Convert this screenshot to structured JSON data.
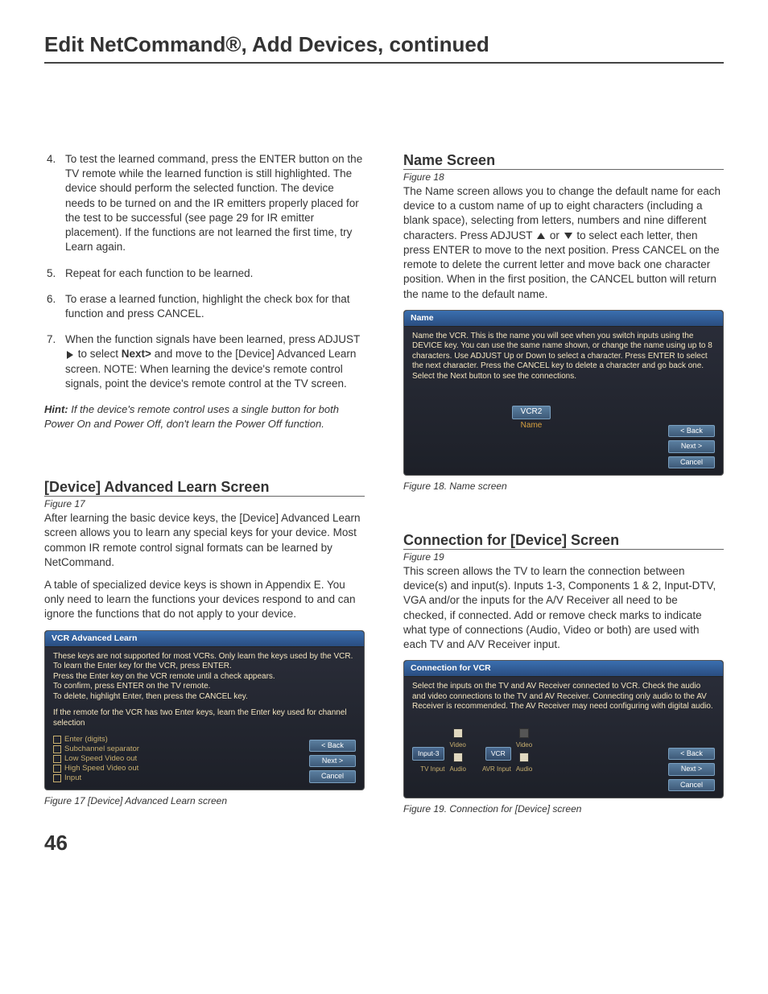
{
  "page": {
    "title": "Edit NetCommand®, Add Devices, continued",
    "number": "46"
  },
  "left": {
    "steps_start": 4,
    "step4": "To test the learned command, press the ENTER button on the TV remote while the learned function is still highlighted.  The device should perform the selected function.  The device needs to be turned on and the IR emitters properly placed for the test to be successful (see page 29 for IR emitter placement).  If the functions are not learned the first time, try Learn again.",
    "step5": "Repeat for each function to be learned.",
    "step6": "To erase a learned function, highlight the check box for that function and press CANCEL.",
    "step7_a": "When the function signals have been learned, press ADJUST ",
    "step7_b": "  to select ",
    "step7_next": "Next>",
    "step7_c": " and move to the [Device] Advanced Learn screen. NOTE: When learning the device's remote control signals, point the device's remote control at the TV screen.",
    "hint_label": "Hint:",
    "hint_text": "  If the device's remote control uses a single button for both Power On and Power Off, don't learn the Power Off function.",
    "adv_title": "[Device] Advanced Learn Screen",
    "adv_figref": "Figure 17",
    "adv_p1": "After learning the basic device keys, the [Device] Advanced Learn screen allows you to learn any special keys for your device.  Most common IR remote control signal formats can be learned by NetCommand.",
    "adv_p2": "A table of specialized device keys is shown in Appendix E. You only need to learn the functions your devices respond to and can ignore the functions that do not apply to your device.",
    "panel17": {
      "title": "VCR Advanced Learn",
      "t1": "These keys are not supported for most VCRs. Only learn the keys used by the VCR.",
      "t2": "To learn the Enter key for the VCR, press ENTER.",
      "t3": "Press the Enter key on the VCR remote until a check appears.",
      "t4": "To confirm, press ENTER on the TV remote.",
      "t5": "To delete, highlight Enter, then press the CANCEL key.",
      "t6": "If the remote for the VCR has two Enter keys, learn the Enter key used for channel selection",
      "item1": "Enter (digits)",
      "item2": "Subchannel separator",
      "item3": "Low Speed Video out",
      "item4": "High Speed Video out",
      "item5": "Input",
      "btn_back": "< Back",
      "btn_next": "Next >",
      "btn_cancel": "Cancel"
    },
    "caption17": "Figure 17  [Device] Advanced Learn screen"
  },
  "right": {
    "name_title": "Name Screen",
    "name_figref": "Figure 18",
    "name_p_a": "The Name screen allows you to change the default name for each device to a custom name of up to eight characters (including a blank space), selecting from letters, numbers and nine different characters.  Press ADJUST ",
    "name_p_b": " or ",
    "name_p_c": " to select each letter, then press ENTER to move to the next position.  Press CANCEL on the remote to delete the current letter and move back one character position.  When in the first position, the CANCEL button will return the name to the default name.",
    "panel18": {
      "title": "Name",
      "instr": "Name the VCR.  This is the name you will see when you switch inputs using the DEVICE key.  You can use the same name shown, or change the name using up to 8 characters. Use ADJUST Up or Down to select a character.  Press ENTER to select the next character.  Press the CANCEL key to delete a character and go back one.  Select the Next button to see the connections.",
      "field_value": "VCR2",
      "field_label": "Name",
      "btn_back": "< Back",
      "btn_next": "Next >",
      "btn_cancel": "Cancel"
    },
    "caption18": "Figure 18.  Name screen",
    "conn_title": "Connection for [Device] Screen",
    "conn_figref": "Figure 19",
    "conn_p": "This screen allows the TV to learn the connection between device(s) and input(s).  Inputs 1-3, Components 1 & 2, Input-DTV, VGA and/or the inputs for the A/V Receiver all need to be checked, if connected.  Add or remove check marks to indicate what type of connections (Audio, Video or both) are used with each TV and A/V Receiver input.",
    "panel19": {
      "title": "Connection for VCR",
      "instr": "Select the inputs on the TV and AV Receiver connected to VCR. Check the audio and video connections to the TV and AV Receiver. Connecting only audio to the AV Receiver is recommended.  The AV Receiver may need configuring with digital audio.",
      "left_box": "Input-3",
      "left_label": "TV Input",
      "right_box": "VCR",
      "right_label": "AVR Input",
      "video": "Video",
      "audio": "Audio",
      "btn_back": "< Back",
      "btn_next": "Next >",
      "btn_cancel": "Cancel"
    },
    "caption19": "Figure 19. Connection for [Device] screen"
  }
}
